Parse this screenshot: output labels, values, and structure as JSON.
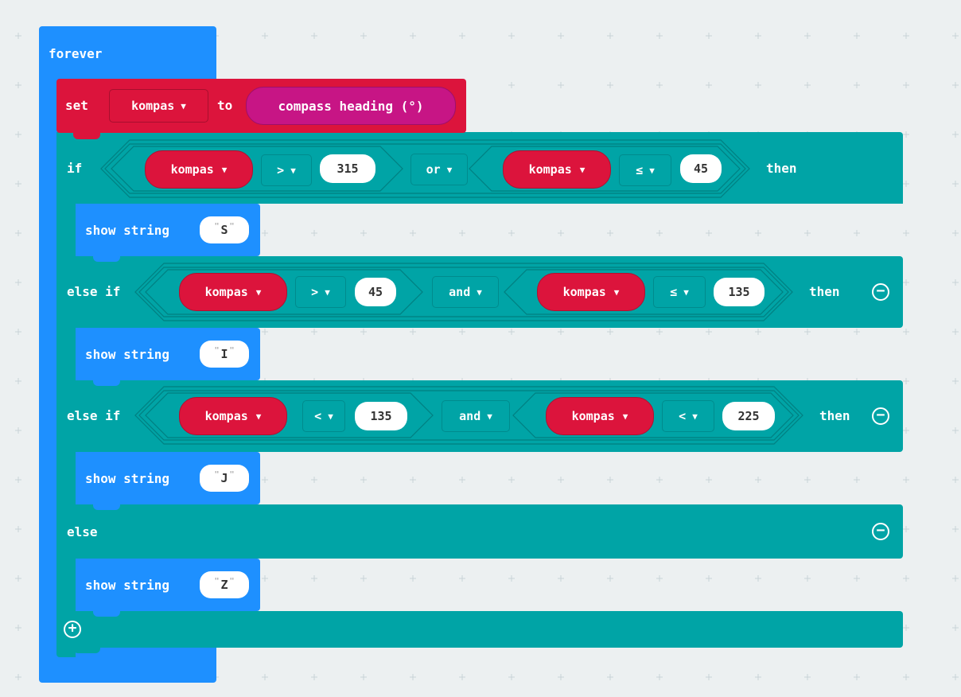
{
  "forever": {
    "label": "forever"
  },
  "set_block": {
    "set": "set",
    "variable": "kompas",
    "to": "to",
    "sensor": "compass heading (°)"
  },
  "if_block": {
    "rows": [
      {
        "keyword": "if",
        "left": {
          "var": "kompas",
          "op": ">",
          "num": "315"
        },
        "logic": "or",
        "right": {
          "var": "kompas",
          "op": "≤",
          "num": "45"
        },
        "then": "then",
        "show": "S"
      },
      {
        "keyword": "else if",
        "left": {
          "var": "kompas",
          "op": ">",
          "num": "45"
        },
        "logic": "and",
        "right": {
          "var": "kompas",
          "op": "≤",
          "num": "135"
        },
        "then": "then",
        "show": "I"
      },
      {
        "keyword": "else if",
        "left": {
          "var": "kompas",
          "op": "<",
          "num": "135"
        },
        "logic": "and",
        "right": {
          "var": "kompas",
          "op": "<",
          "num": "225"
        },
        "then": "then",
        "show": "J"
      }
    ],
    "else_label": "else",
    "else_show": "Z",
    "show_string_label": "show string",
    "add_icon": "plus-circle-icon",
    "remove_icon": "minus-circle-icon",
    "dropdown_icon": "triangle-down-icon"
  },
  "colors": {
    "background": "#ecf0f1",
    "basic_blue": "#1e90ff",
    "variables_red": "#dc143c",
    "logic_teal": "#00a4a6",
    "input_magenta": "#c71585"
  }
}
